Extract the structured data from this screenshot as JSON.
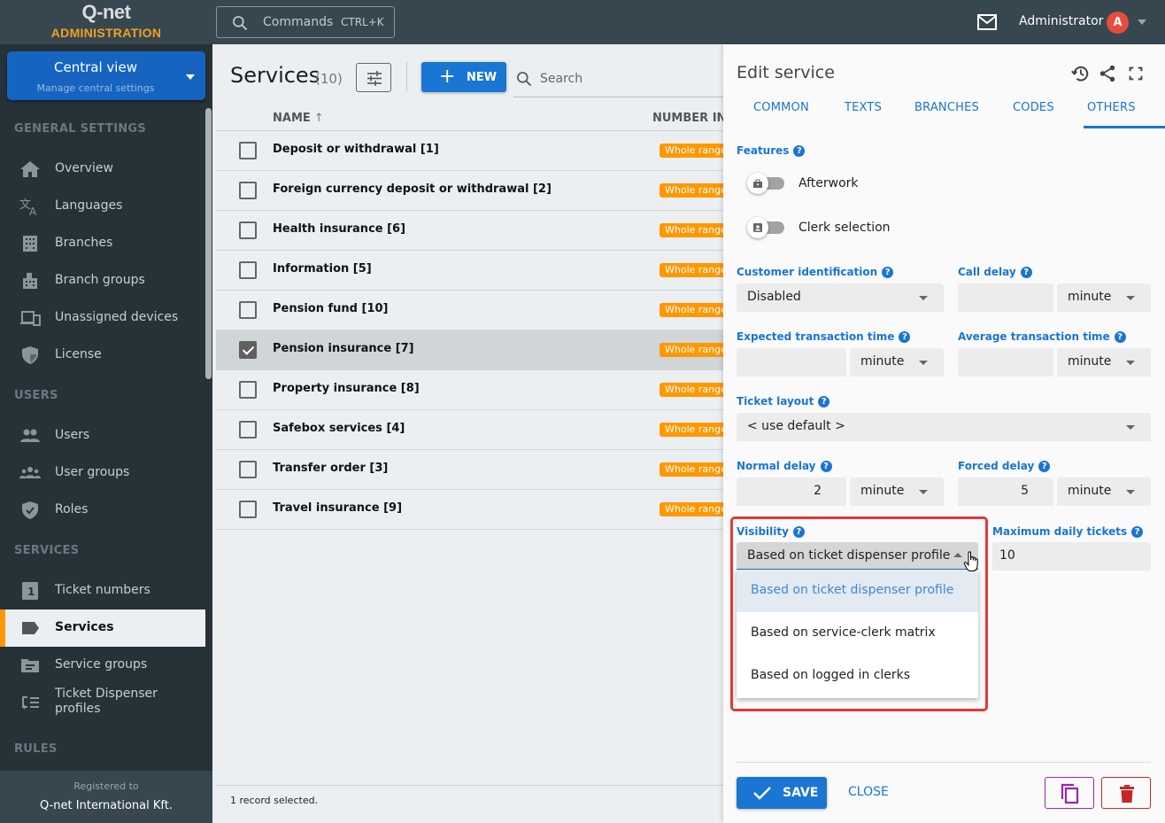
{
  "app": {
    "brand": "Q-net",
    "subtitle": "ADMINISTRATION"
  },
  "topbar": {
    "commands_label": "Commands",
    "commands_shortcut": "CTRL+K",
    "user_name": "Administrator",
    "user_initial": "A"
  },
  "sidebar": {
    "context": {
      "title": "Central view",
      "subtitle": "Manage central settings"
    },
    "sections": [
      {
        "label": "GENERAL SETTINGS"
      },
      {
        "label": "USERS"
      },
      {
        "label": "SERVICES"
      },
      {
        "label": "RULES"
      }
    ],
    "items": [
      {
        "label": "Overview",
        "icon": "home-icon"
      },
      {
        "label": "Languages",
        "icon": "translate-icon"
      },
      {
        "label": "Branches",
        "icon": "building-icon"
      },
      {
        "label": "Branch groups",
        "icon": "buildings-icon"
      },
      {
        "label": "Unassigned devices",
        "icon": "devices-icon"
      },
      {
        "label": "License",
        "icon": "shield-icon"
      },
      {
        "label": "Users",
        "icon": "users-icon"
      },
      {
        "label": "User groups",
        "icon": "user-groups-icon"
      },
      {
        "label": "Roles",
        "icon": "shield-check-icon"
      },
      {
        "label": "Ticket numbers",
        "icon": "number-one-icon"
      },
      {
        "label": "Services",
        "icon": "label-icon",
        "active": true
      },
      {
        "label": "Service groups",
        "icon": "folder-icon"
      },
      {
        "label": "Ticket Dispenser profiles",
        "icon": "list-icon"
      }
    ],
    "footer": {
      "registered_label": "Registered to",
      "company": "Q-net International Kft."
    }
  },
  "list": {
    "title": "Services",
    "count": "(10)",
    "new_label": "NEW",
    "search_placeholder": "Search",
    "columns": [
      {
        "label": "NAME",
        "sort": "ascending"
      },
      {
        "label": "NUMBER INT"
      }
    ],
    "rows": [
      {
        "name": "Deposit or withdrawal [1]",
        "badge": "Whole range",
        "selected": false
      },
      {
        "name": "Foreign currency deposit or withdrawal [2]",
        "badge": "Whole range",
        "selected": false
      },
      {
        "name": "Health insurance [6]",
        "badge": "Whole range",
        "selected": false
      },
      {
        "name": "Information [5]",
        "badge": "Whole range",
        "selected": false
      },
      {
        "name": "Pension fund [10]",
        "badge": "Whole range",
        "selected": false
      },
      {
        "name": "Pension insurance [7]",
        "badge": "Whole range",
        "selected": true
      },
      {
        "name": "Property insurance [8]",
        "badge": "Whole range",
        "selected": false
      },
      {
        "name": "Safebox services [4]",
        "badge": "Whole range",
        "selected": false
      },
      {
        "name": "Transfer order [3]",
        "badge": "Whole range",
        "selected": false
      },
      {
        "name": "Travel insurance [9]",
        "badge": "Whole range",
        "selected": false
      }
    ],
    "footer": "1 record selected."
  },
  "panel": {
    "title": "Edit service",
    "tabs": [
      {
        "label": "COMMON"
      },
      {
        "label": "TEXTS"
      },
      {
        "label": "BRANCHES"
      },
      {
        "label": "CODES"
      },
      {
        "label": "OTHERS",
        "active": true
      }
    ],
    "features_label": "Features",
    "toggles": [
      {
        "label": "Afterwork",
        "on": false
      },
      {
        "label": "Clerk selection",
        "on": false
      }
    ],
    "fields": {
      "customer_identification": {
        "label": "Customer identification",
        "value": "Disabled"
      },
      "call_delay": {
        "label": "Call delay",
        "value": "",
        "unit": "minute"
      },
      "expected_transaction_time": {
        "label": "Expected transaction time",
        "value": "",
        "unit": "minute"
      },
      "average_transaction_time": {
        "label": "Average transaction time",
        "value": "",
        "unit": "minute"
      },
      "ticket_layout": {
        "label": "Ticket layout",
        "value": "< use default >"
      },
      "normal_delay": {
        "label": "Normal delay",
        "value": "2",
        "unit": "minute"
      },
      "forced_delay": {
        "label": "Forced delay",
        "value": "5",
        "unit": "minute"
      },
      "visibility": {
        "label": "Visibility",
        "value": "Based on ticket dispenser profile",
        "options": [
          "Based on ticket dispenser profile",
          "Based on service-clerk matrix",
          "Based on logged in clerks"
        ]
      },
      "maximum_daily_tickets": {
        "label": "Maximum daily tickets",
        "value": "10"
      }
    },
    "help_glyph": "?",
    "save_label": "SAVE",
    "close_label": "CLOSE"
  },
  "colors": {
    "accent": "#1976d2",
    "sidebar_bg": "#263238",
    "topbar_bg": "#37474f",
    "active_marker": "#ff9800",
    "badge": "#ff9800",
    "highlight_box": "#e53935",
    "copy": "#9c27b0",
    "delete": "#c62828"
  }
}
